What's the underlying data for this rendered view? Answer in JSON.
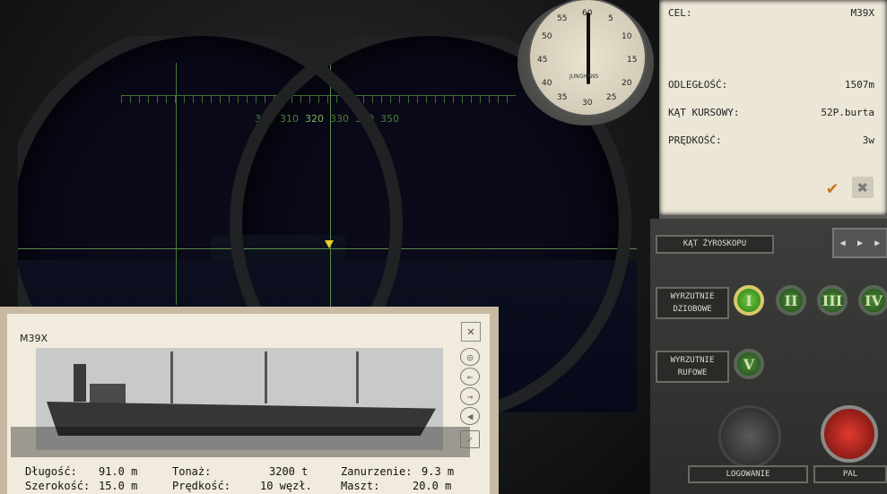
{
  "scope": {
    "bearings": [
      "300",
      "310",
      "320",
      "330",
      "340",
      "350"
    ]
  },
  "stopwatch": {
    "numbers": [
      "60",
      "5",
      "10",
      "15",
      "20",
      "25",
      "30",
      "35",
      "40",
      "45",
      "50",
      "55"
    ],
    "brand": "JUNGHANS"
  },
  "target": {
    "rows": [
      {
        "label": "CEL:",
        "value": "M39X"
      },
      {
        "label": "ODLEGŁOŚĆ:",
        "value": "1507m"
      },
      {
        "label": "KĄT KURSOWY:",
        "value": "52P.burta"
      },
      {
        "label": "PRĘDKOŚĆ:",
        "value": "3w"
      }
    ],
    "confirm_icon": "check-icon",
    "cancel_icon": "x-icon",
    "confirm_color": "#c9761b"
  },
  "controls": {
    "gyro_label": "KĄT ŻYROSKOPU",
    "bow_label": "WYRZUTNIE DZIOBOWE",
    "bow_tubes": [
      "I",
      "II",
      "III",
      "IV"
    ],
    "stern_label": "WYRZUTNIE RUFOWE",
    "stern_tubes": [
      "V"
    ],
    "log_label": "LOGOWANIE",
    "fire_label": "PAL",
    "tube_color": "#4e8a3a",
    "fire_color": "#e23a30"
  },
  "card": {
    "name": "M39X",
    "close_icon": "x-icon",
    "nav_icons": [
      "target-icon",
      "arrow-left-icon",
      "arrow-right-icon",
      "sound-icon",
      "check-icon"
    ],
    "specs": [
      {
        "label": "Długość:",
        "value": "91.0 m"
      },
      {
        "label": "Tonaż:",
        "value": "3200 t"
      },
      {
        "label": "Zanurzenie:",
        "value": "9.3 m"
      },
      {
        "label": "Szerokość:",
        "value": "15.0 m"
      },
      {
        "label": "Prędkość:",
        "value": "10 węzł."
      },
      {
        "label": "Maszt:",
        "value": "20.0 m"
      }
    ]
  }
}
